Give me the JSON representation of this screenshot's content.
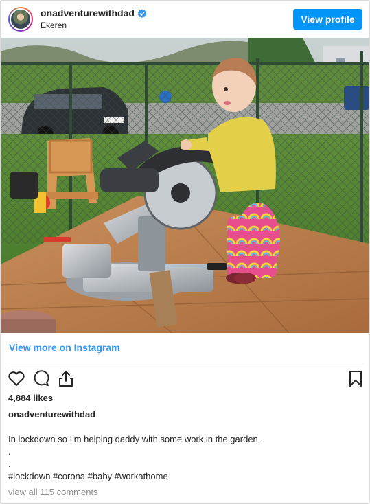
{
  "header": {
    "username": "onadventurewithdad",
    "location": "Ekeren",
    "view_profile_label": "View profile",
    "verified_icon": "verified-badge-icon"
  },
  "post": {
    "image_alt": "Toddler in a yellow cardigan and rainbow leggings standing next to a miter saw on a garden table",
    "view_more_label": "View more on Instagram"
  },
  "actions": {
    "icons": [
      "heart-icon",
      "comment-icon",
      "share-icon",
      "bookmark-icon"
    ]
  },
  "stats": {
    "likes": "4,884 likes"
  },
  "caption": {
    "username": "onadventurewithdad",
    "line1": "In lockdown so I'm helping daddy with some work in the garden.",
    "line2": ".",
    "line3": ".",
    "hashtags": "#lockdown #corona #baby #workathome"
  },
  "comments": {
    "label": "view all 115 comments"
  },
  "colors": {
    "accent": "#0095f6",
    "link": "#3897f0",
    "muted": "#8e8e8e",
    "text": "#262626"
  }
}
